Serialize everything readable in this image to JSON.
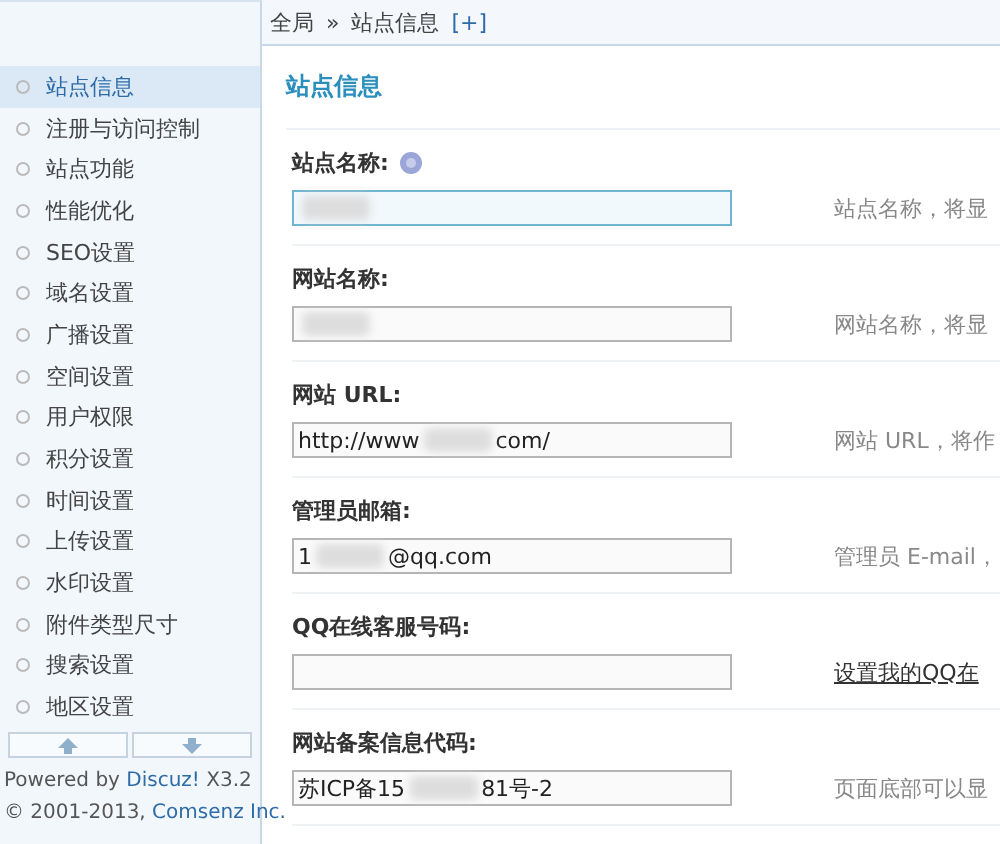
{
  "breadcrumb": {
    "items": [
      "全局",
      "站点信息"
    ],
    "separator": "»",
    "add": "[+]"
  },
  "sidebar": {
    "items": [
      {
        "label": "站点信息",
        "selected": true
      },
      {
        "label": "注册与访问控制",
        "selected": false
      },
      {
        "label": "站点功能",
        "selected": false
      },
      {
        "label": "性能优化",
        "selected": false
      },
      {
        "label": "SEO设置",
        "selected": false
      },
      {
        "label": "域名设置",
        "selected": false
      },
      {
        "label": "广播设置",
        "selected": false
      },
      {
        "label": "空间设置",
        "selected": false
      },
      {
        "label": "用户权限",
        "selected": false
      },
      {
        "label": "积分设置",
        "selected": false
      },
      {
        "label": "时间设置",
        "selected": false
      },
      {
        "label": "上传设置",
        "selected": false
      },
      {
        "label": "水印设置",
        "selected": false
      },
      {
        "label": "附件类型尺寸",
        "selected": false
      },
      {
        "label": "搜索设置",
        "selected": false
      },
      {
        "label": "地区设置",
        "selected": false
      }
    ],
    "footer": {
      "powered_prefix": "Powered by ",
      "product": "Discuz!",
      "version": " X3.2",
      "copyright_prefix": "© 2001-2013, ",
      "company": "Comsenz Inc."
    }
  },
  "main": {
    "title": "站点信息",
    "fields": [
      {
        "label": "站点名称:",
        "help": true,
        "focused": true,
        "masked": true,
        "hint": {
          "kind": "text",
          "text": "站点名称，将显"
        }
      },
      {
        "label": "网站名称:",
        "focused": false,
        "masked": true,
        "hint": {
          "kind": "text",
          "text": "网站名称，将显"
        }
      },
      {
        "label": "网站 URL:",
        "focused": false,
        "value_start": "http://www",
        "masked": true,
        "value_end": "com/",
        "hint": {
          "kind": "text",
          "text": "网站 URL，将作"
        }
      },
      {
        "label": "管理员邮箱:",
        "focused": false,
        "value_start": "1",
        "masked": true,
        "value_end": "@qq.com",
        "hint": {
          "kind": "text",
          "text": "管理员 E-mail，"
        }
      },
      {
        "label": "QQ在线客服号码:",
        "focused": false,
        "hint": {
          "kind": "link",
          "text": "设置我的QQ在"
        }
      },
      {
        "label": "网站备案信息代码:",
        "focused": false,
        "value_start": "苏ICP备15",
        "masked": true,
        "value_end": "81号-2",
        "hint": {
          "kind": "text",
          "text": "页面底部可以显"
        }
      }
    ]
  }
}
